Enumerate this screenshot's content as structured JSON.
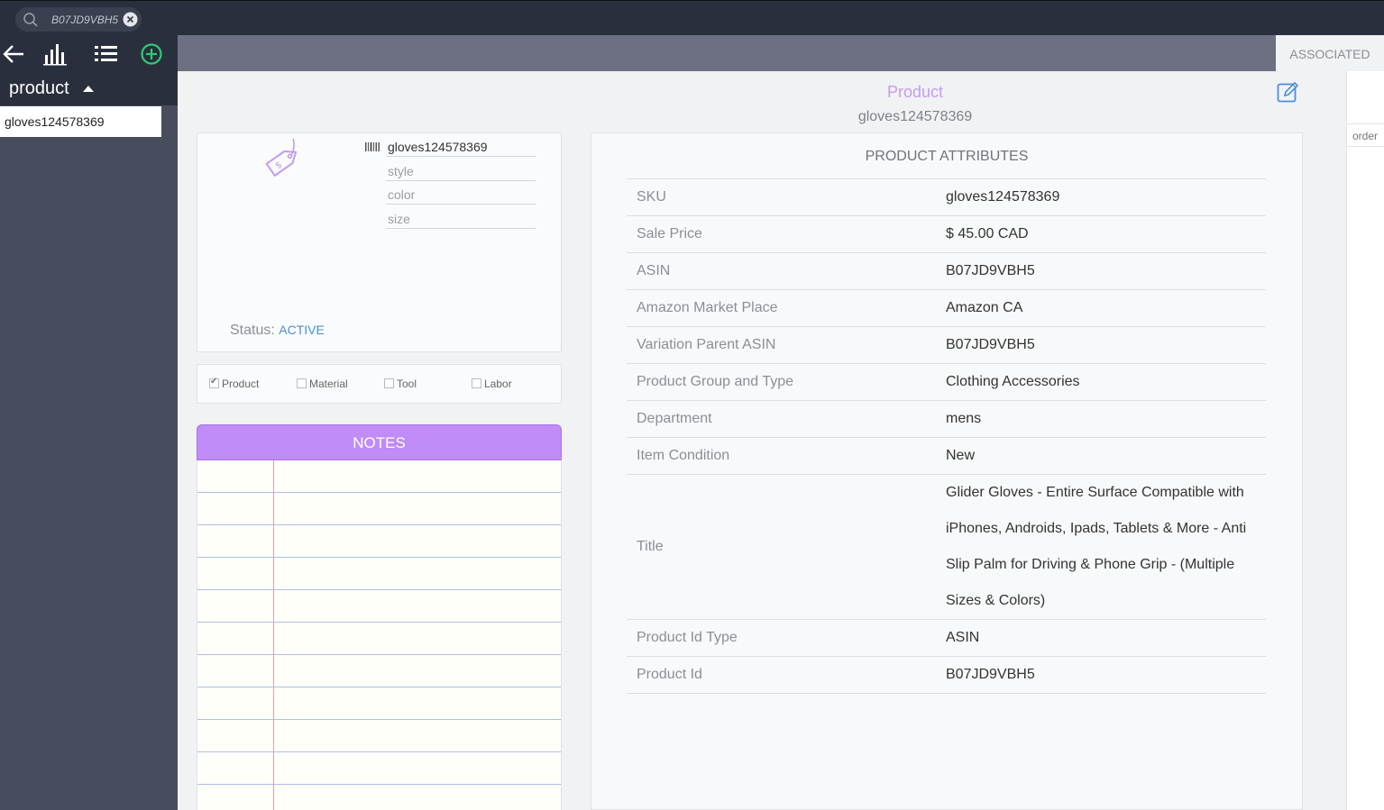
{
  "search": {
    "value": "B07JD9VBH5"
  },
  "sidebar": {
    "section_label": "product",
    "items": [
      {
        "label": "gloves124578369"
      }
    ]
  },
  "tabs": {
    "associated": "ASSOCIATED",
    "order": "order"
  },
  "header": {
    "title": "Product",
    "subtitle": "gloves124578369"
  },
  "card": {
    "sku_field": "gloves124578369",
    "style_placeholder": "style",
    "color_placeholder": "color",
    "size_placeholder": "size",
    "status_label": "Status:",
    "status_value": "ACTIVE"
  },
  "types": [
    {
      "label": "Product",
      "checked": true
    },
    {
      "label": "Material",
      "checked": false
    },
    {
      "label": "Tool",
      "checked": false
    },
    {
      "label": "Labor",
      "checked": false
    }
  ],
  "notes": {
    "title": "NOTES"
  },
  "attributes": {
    "title": "PRODUCT ATTRIBUTES",
    "rows": [
      {
        "key": "SKU",
        "value": "gloves124578369"
      },
      {
        "key": "Sale Price",
        "value": "$ 45.00 CAD"
      },
      {
        "key": "ASIN",
        "value": "B07JD9VBH5"
      },
      {
        "key": "Amazon Market Place",
        "value": "Amazon CA"
      },
      {
        "key": "Variation Parent ASIN",
        "value": "B07JD9VBH5"
      },
      {
        "key": "Product Group and Type",
        "value": "Clothing Accessories"
      },
      {
        "key": "Department",
        "value": "mens"
      },
      {
        "key": "Item Condition",
        "value": "New"
      },
      {
        "key": "Title",
        "value": "Glider Gloves - Entire Surface Compatible with iPhones, Androids, Ipads, Tablets & More - Anti Slip Palm for Driving & Phone Grip - (Multiple Sizes & Colors)"
      },
      {
        "key": "Product Id Type",
        "value": "ASIN"
      },
      {
        "key": "Product Id",
        "value": "B07JD9VBH5"
      }
    ]
  },
  "colors": {
    "accent_purple": "#c08cf7",
    "add_green": "#2ecc71",
    "link_blue": "#4a8ed8"
  }
}
